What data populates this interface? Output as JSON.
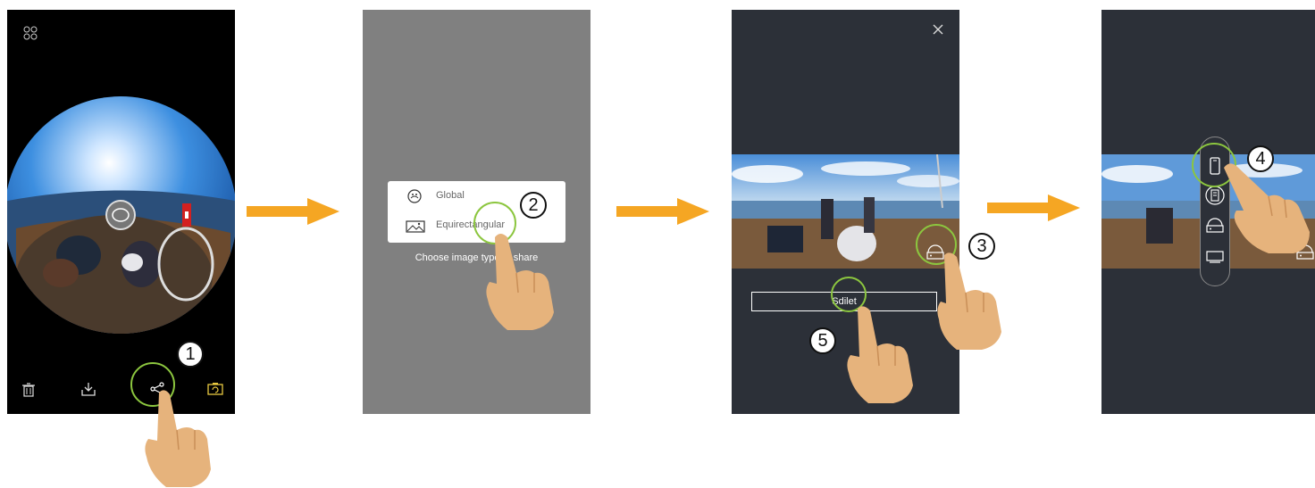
{
  "steps": {
    "one": "1",
    "two": "2",
    "three": "3",
    "four": "4",
    "five": "5"
  },
  "screen2": {
    "options": [
      {
        "label": "Global",
        "icon": "global-sphere-icon"
      },
      {
        "label": "Equirectangular",
        "icon": "equirectangular-landscape-icon"
      }
    ],
    "caption": "Choose image type to share"
  },
  "screen3": {
    "share_button_label": "Sdilet",
    "close_icon": "close-icon"
  },
  "screen1": {
    "toolbar_icons": [
      "trash-icon",
      "download-icon",
      "share-icon",
      "camera-switch-icon"
    ],
    "menu_icon": "grid-dots-icon"
  },
  "colors": {
    "highlight": "#8cc63f",
    "arrow": "#f5a623",
    "dark_bg": "#2c3038"
  }
}
